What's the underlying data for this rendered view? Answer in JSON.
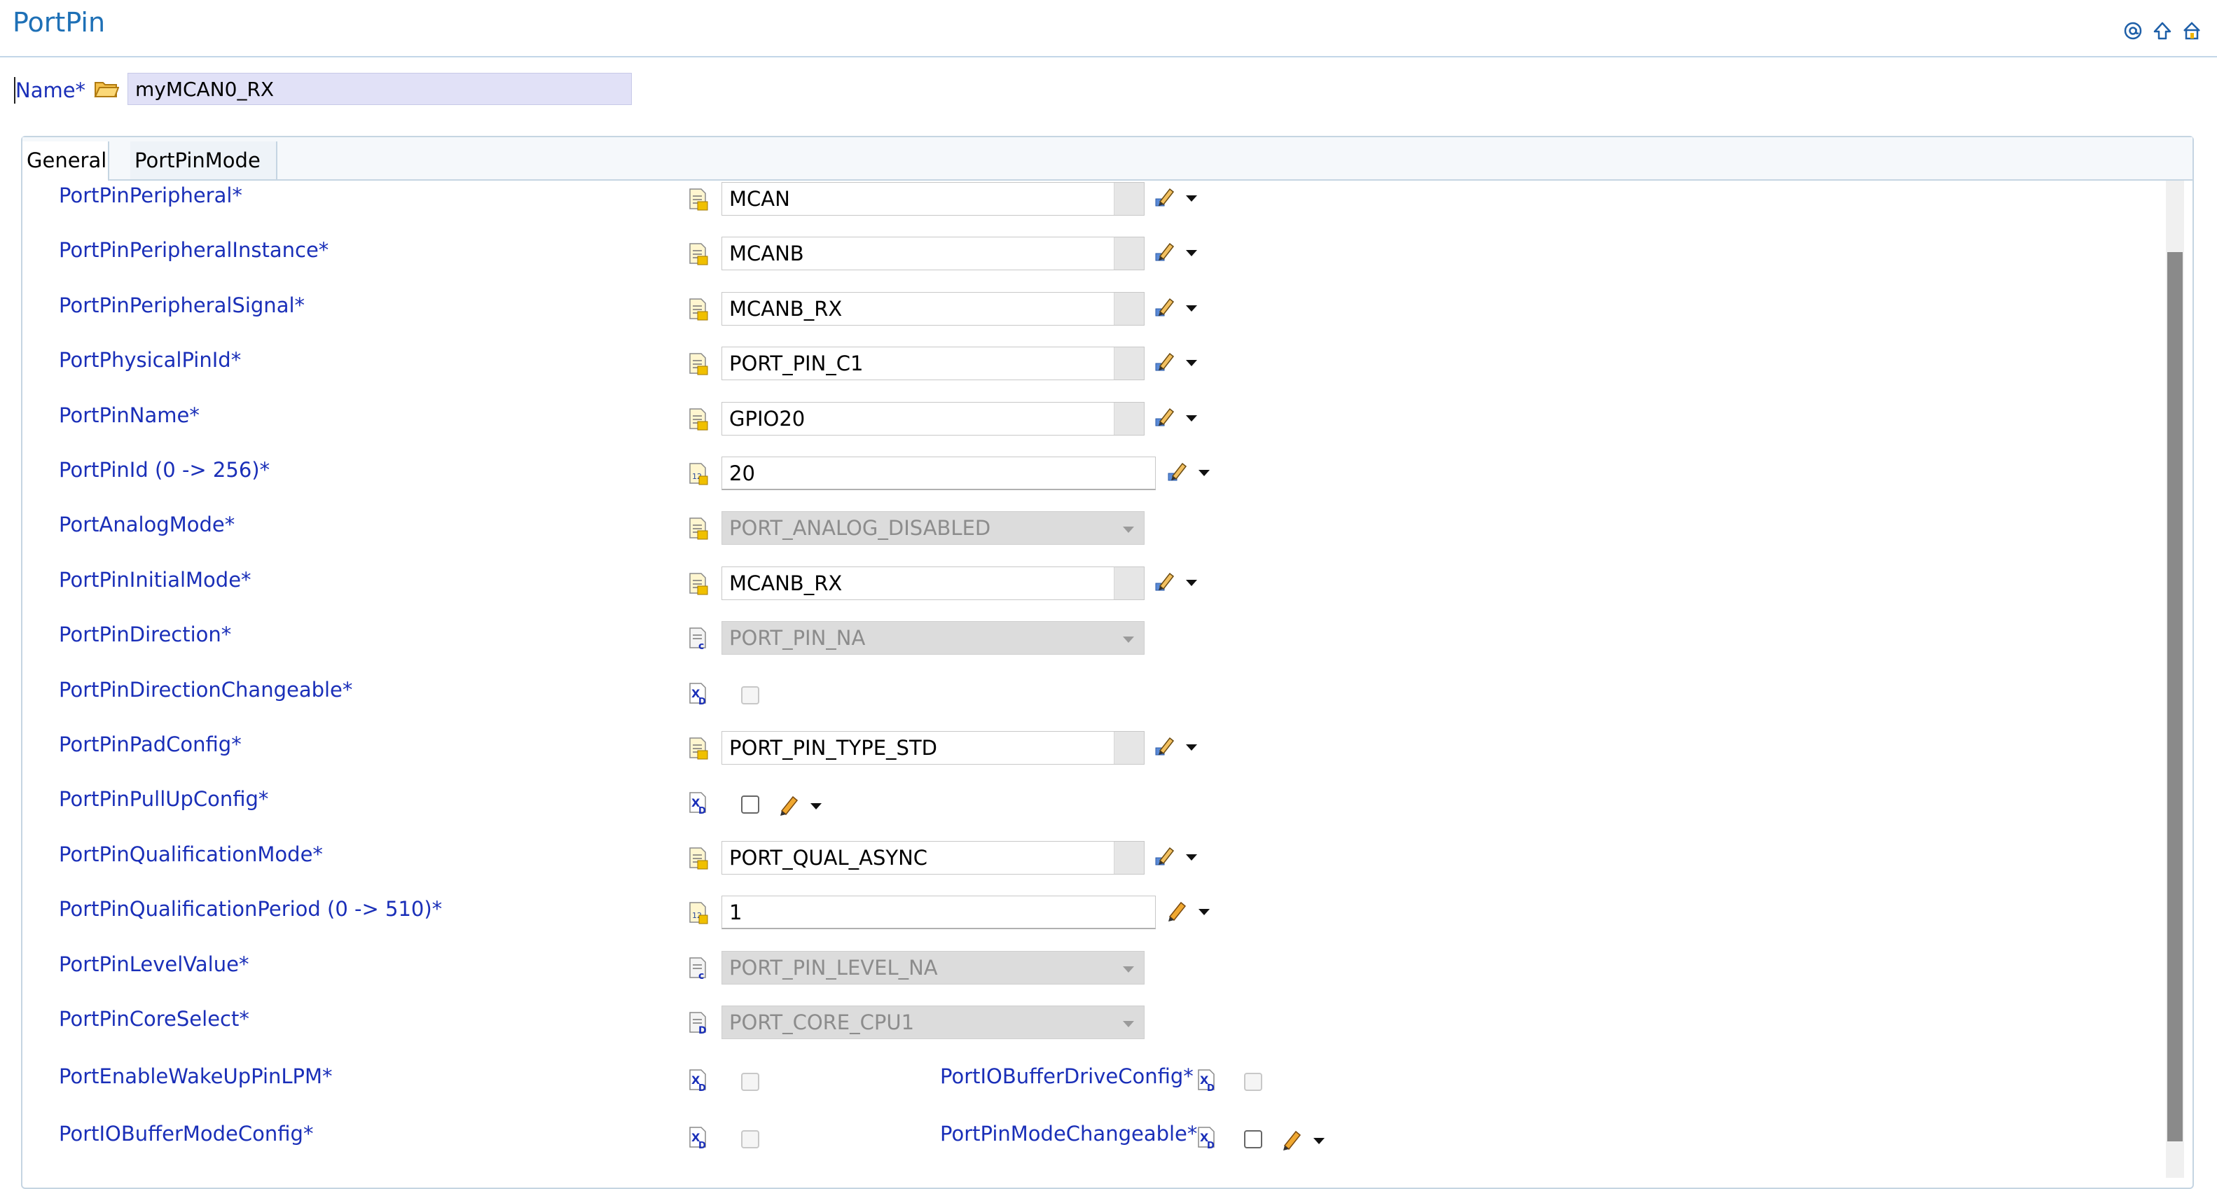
{
  "header": {
    "title": "PortPin",
    "icons": [
      "at-sign-icon",
      "up-arrow-icon",
      "home-icon"
    ]
  },
  "name_field": {
    "label": "Name*",
    "value": "myMCAN0_RX"
  },
  "tabs": [
    {
      "label": "General",
      "active": true
    },
    {
      "label": "PortPinMode",
      "active": false
    }
  ],
  "rows": [
    {
      "label": "PortPinPeripheral*",
      "icon": "enum-param-icon",
      "kind": "combo",
      "value": "MCAN"
    },
    {
      "label": "PortPinPeripheralInstance*",
      "icon": "enum-param-icon",
      "kind": "combo",
      "value": "MCANB"
    },
    {
      "label": "PortPinPeripheralSignal*",
      "icon": "enum-param-icon",
      "kind": "combo",
      "value": "MCANB_RX"
    },
    {
      "label": "PortPhysicalPinId*",
      "icon": "enum-param-icon",
      "kind": "combo",
      "value": "PORT_PIN_C1"
    },
    {
      "label": "PortPinName*",
      "icon": "enum-param-icon",
      "kind": "combo",
      "value": "GPIO20"
    },
    {
      "label": "PortPinId (0 -> 256)*",
      "icon": "integer-param-icon",
      "kind": "number",
      "value": "20"
    },
    {
      "label": "PortAnalogMode*",
      "icon": "enum-param-icon",
      "kind": "disabled",
      "value": "PORT_ANALOG_DISABLED"
    },
    {
      "label": "PortPinInitialMode*",
      "icon": "enum-param-icon",
      "kind": "combo",
      "value": "MCANB_RX"
    },
    {
      "label": "PortPinDirection*",
      "icon": "calculated-param-icon",
      "kind": "disabled",
      "value": "PORT_PIN_NA"
    },
    {
      "label": "PortPinDirectionChangeable*",
      "icon": "boolean-param-icon",
      "kind": "checkbox-disabled",
      "value": ""
    },
    {
      "label": "PortPinPadConfig*",
      "icon": "enum-param-icon",
      "kind": "combo",
      "value": "PORT_PIN_TYPE_STD"
    },
    {
      "label": "PortPinPullUpConfig*",
      "icon": "boolean-param-icon",
      "kind": "checkbox",
      "value": ""
    },
    {
      "label": "PortPinQualificationMode*",
      "icon": "enum-param-icon",
      "kind": "combo",
      "value": "PORT_QUAL_ASYNC"
    },
    {
      "label": "PortPinQualificationPeriod (0 -> 510)*",
      "icon": "integer-param-icon",
      "kind": "number",
      "value": "1"
    },
    {
      "label": "PortPinLevelValue*",
      "icon": "calculated-param-icon",
      "kind": "disabled",
      "value": "PORT_PIN_LEVEL_NA"
    },
    {
      "label": "PortPinCoreSelect*",
      "icon": "derived-param-icon",
      "kind": "disabled",
      "value": "PORT_CORE_CPU1"
    }
  ],
  "pair_rows": [
    {
      "left": {
        "label": "PortEnableWakeUpPinLPM*",
        "kind": "checkbox-disabled"
      },
      "right": {
        "label": "PortIOBufferDriveConfig*",
        "kind": "checkbox-disabled"
      }
    },
    {
      "left": {
        "label": "PortIOBufferModeConfig*",
        "kind": "checkbox-disabled"
      },
      "right": {
        "label": "PortPinModeChangeable*",
        "kind": "checkbox"
      }
    }
  ]
}
